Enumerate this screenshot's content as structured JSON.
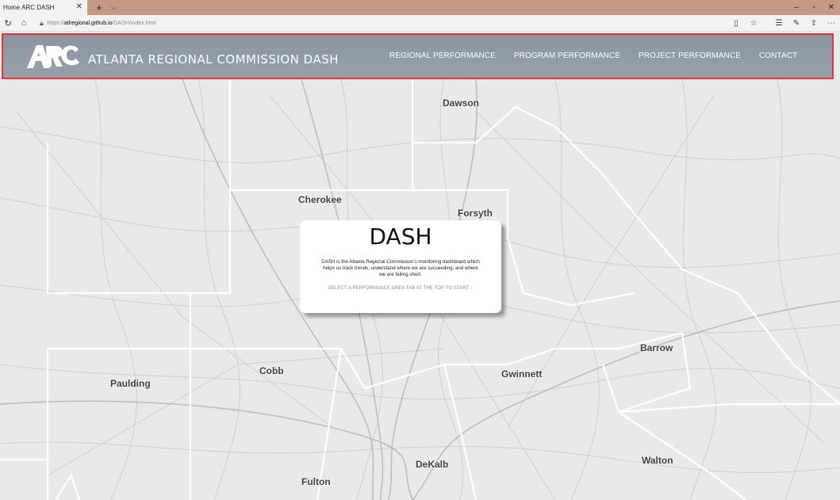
{
  "browser": {
    "tab_title": "Home ARC DASH",
    "url_scheme": "https://",
    "url_host": "atlregional.github.io",
    "url_path": "/DASH/index.html"
  },
  "header": {
    "title": "ATLANTA REGIONAL COMMISSION DASH",
    "nav": [
      "REGIONAL PERFORMANCE",
      "PROGRAM PERFORMANCE",
      "PROJECT PERFORMANCE",
      "CONTACT"
    ]
  },
  "map": {
    "counties": [
      "Dawson",
      "Cherokee",
      "Forsyth",
      "Barrow",
      "Cobb",
      "Gwinnett",
      "Paulding",
      "DeKalb",
      "Walton",
      "Fulton"
    ]
  },
  "card": {
    "title": "DASH",
    "body": "DASH is the Atlanta Regional Commission's monitoring dashboard which helps us track trends, understand where we are succeeding, and where we are failing short.",
    "cta": "SELECT A PERFORMANCE AREA TAB AT THE TOP TO START ↑"
  },
  "colors": {
    "header_bg": "#939ba5",
    "header_border": "#d63a3a",
    "tabbar_bg": "#c59a85"
  }
}
